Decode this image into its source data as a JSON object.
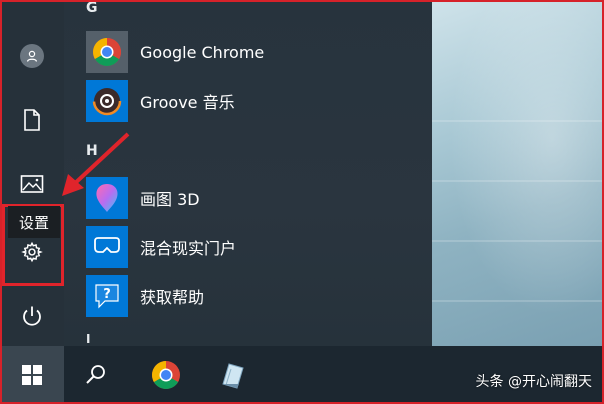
{
  "start_menu": {
    "sections": [
      {
        "letter": "G",
        "apps": [
          {
            "label": "Google Chrome",
            "icon": "chrome-icon"
          },
          {
            "label": "Groove 音乐",
            "icon": "groove-music-icon"
          }
        ]
      },
      {
        "letter": "H",
        "apps": [
          {
            "label": "画图 3D",
            "icon": "paint-3d-icon"
          },
          {
            "label": "混合现实门户",
            "icon": "mixed-reality-portal-icon"
          },
          {
            "label": "获取帮助",
            "icon": "get-help-icon"
          }
        ]
      }
    ],
    "next_section_letter": "I"
  },
  "left_rail": {
    "items": [
      {
        "name": "user-account",
        "icon": "user-icon"
      },
      {
        "name": "documents",
        "icon": "document-icon"
      },
      {
        "name": "pictures",
        "icon": "picture-icon"
      },
      {
        "name": "settings",
        "icon": "gear-icon"
      },
      {
        "name": "power",
        "icon": "power-icon"
      }
    ],
    "tooltip": "设置"
  },
  "taskbar": {
    "items": [
      {
        "name": "start",
        "icon": "windows-logo-icon"
      },
      {
        "name": "search",
        "icon": "search-icon"
      },
      {
        "name": "chrome",
        "icon": "chrome-icon"
      },
      {
        "name": "notepad-app",
        "icon": "notepad-icon"
      }
    ]
  },
  "watermark": "头条 @开心闹翻天",
  "colors": {
    "accent": "#0078d7",
    "highlight_red": "#e0242b",
    "panel": "#27333d"
  }
}
